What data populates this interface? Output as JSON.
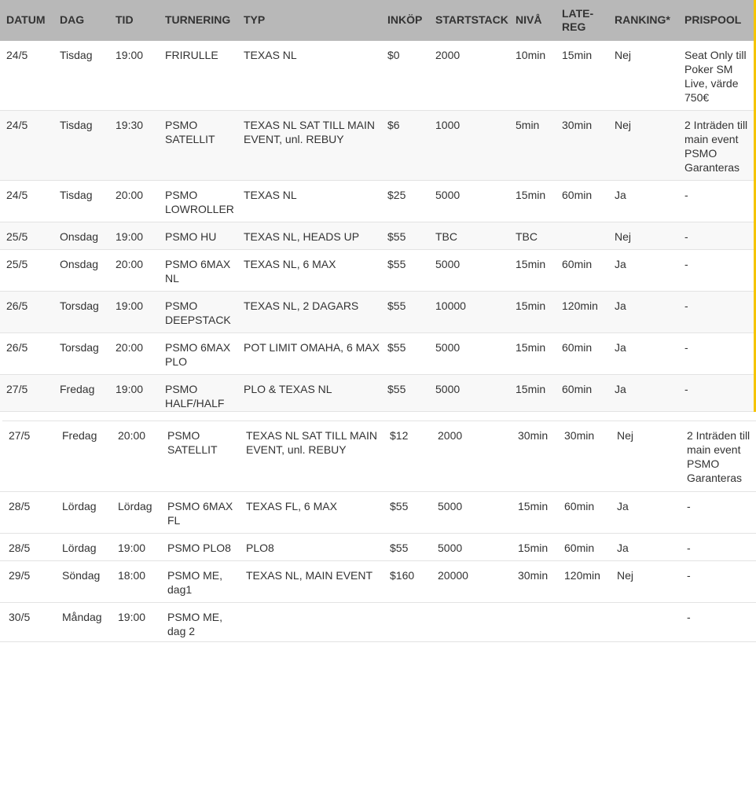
{
  "headers": {
    "datum": "DATUM",
    "dag": "DAG",
    "tid": "TID",
    "turnering": "TURNERING",
    "typ": "TYP",
    "inkop": "INKÖP",
    "startstack": "STARTSTACK",
    "niva": "NIVÅ",
    "late_reg": "LATE-REG",
    "ranking": "RANKING*",
    "prispool": "PRISPOOL"
  },
  "rows": [
    {
      "datum": "24/5",
      "dag": "Tisdag",
      "tid": "19:00",
      "turnering": "FRIRULLE",
      "typ": "TEXAS NL",
      "inkop": "$0",
      "startstack": "2000",
      "niva": "10min",
      "late_reg": "15min",
      "ranking": "Nej",
      "prispool": "Seat Only till Poker SM Live, värde 750€"
    },
    {
      "datum": "24/5",
      "dag": "Tisdag",
      "tid": "19:30",
      "turnering": "PSMO SATELLIT",
      "typ": "TEXAS NL SAT TILL MAIN EVENT, unl. REBUY",
      "inkop": "$6",
      "startstack": "1000",
      "niva": "5min",
      "late_reg": "30min",
      "ranking": "Nej",
      "prispool": "2 Inträden till main event PSMO Garanteras"
    },
    {
      "datum": "24/5",
      "dag": "Tisdag",
      "tid": "20:00",
      "turnering": "PSMO LOWROLLER",
      "typ": "TEXAS NL",
      "inkop": "$25",
      "startstack": "5000",
      "niva": "15min",
      "late_reg": "60min",
      "ranking": "Ja",
      "prispool": "-"
    },
    {
      "datum": "25/5",
      "dag": "Onsdag",
      "tid": "19:00",
      "turnering": "PSMO HU",
      "typ": "TEXAS NL, HEADS UP",
      "inkop": "$55",
      "startstack": "TBC",
      "niva": "TBC",
      "late_reg": "",
      "ranking": "Nej",
      "prispool": "-"
    },
    {
      "datum": "25/5",
      "dag": "Onsdag",
      "tid": "20:00",
      "turnering": "PSMO 6MAX NL",
      "typ": "TEXAS NL, 6 MAX",
      "inkop": "$55",
      "startstack": "5000",
      "niva": "15min",
      "late_reg": "60min",
      "ranking": "Ja",
      "prispool": "-"
    },
    {
      "datum": "26/5",
      "dag": "Torsdag",
      "tid": "19:00",
      "turnering": "PSMO DEEPSTACK",
      "typ": "TEXAS NL, 2 DAGARS",
      "inkop": "$55",
      "startstack": "10000",
      "niva": "15min",
      "late_reg": "120min",
      "ranking": "Ja",
      "prispool": "-"
    },
    {
      "datum": "26/5",
      "dag": "Torsdag",
      "tid": "20:00",
      "turnering": "PSMO 6MAX PLO",
      "typ": "POT LIMIT OMAHA, 6 MAX",
      "inkop": "$55",
      "startstack": "5000",
      "niva": "15min",
      "late_reg": "60min",
      "ranking": "Ja",
      "prispool": "-"
    },
    {
      "datum": "27/5",
      "dag": "Fredag",
      "tid": "19:00",
      "turnering": "PSMO HALF/HALF",
      "typ": "PLO & TEXAS NL",
      "inkop": "$55",
      "startstack": "5000",
      "niva": "15min",
      "late_reg": "60min",
      "ranking": "Ja",
      "prispool": "-"
    },
    {
      "datum": "27/5",
      "dag": "Fredag",
      "tid": "20:00",
      "turnering": "PSMO SATELLIT",
      "typ": "TEXAS NL SAT TILL MAIN EVENT, unl. REBUY",
      "inkop": "$12",
      "startstack": "2000",
      "niva": "30min",
      "late_reg": "30min",
      "ranking": "Nej",
      "prispool": "2 Inträden till main event PSMO Garanteras"
    },
    {
      "datum": "28/5",
      "dag": "Lördag",
      "tid": "Lördag",
      "turnering": "PSMO 6MAX FL",
      "typ": "TEXAS FL, 6 MAX",
      "inkop": "$55",
      "startstack": "5000",
      "niva": "15min",
      "late_reg": "60min",
      "ranking": "Ja",
      "prispool": "-"
    },
    {
      "datum": "28/5",
      "dag": "Lördag",
      "tid": "19:00",
      "turnering": "PSMO PLO8",
      "typ": "PLO8",
      "inkop": "$55",
      "startstack": "5000",
      "niva": "15min",
      "late_reg": "60min",
      "ranking": "Ja",
      "prispool": "-"
    },
    {
      "datum": "29/5",
      "dag": "Söndag",
      "tid": "18:00",
      "turnering": "PSMO ME, dag1",
      "typ": "TEXAS NL, MAIN EVENT",
      "inkop": "$160",
      "startstack": "20000",
      "niva": "30min",
      "late_reg": "120min",
      "ranking": "Nej",
      "prispool": "-"
    },
    {
      "datum": "30/5",
      "dag": "Måndag",
      "tid": "19:00",
      "turnering": "PSMO ME, dag 2",
      "typ": "",
      "inkop": "",
      "startstack": "",
      "niva": "",
      "late_reg": "",
      "ranking": "",
      "prispool": "-"
    }
  ],
  "colors": {
    "header_bg": "#b8b8b8",
    "accent": "#f5c400",
    "alt_row": "#f8f8f8",
    "border": "#e3e3e3",
    "text": "#333333"
  }
}
